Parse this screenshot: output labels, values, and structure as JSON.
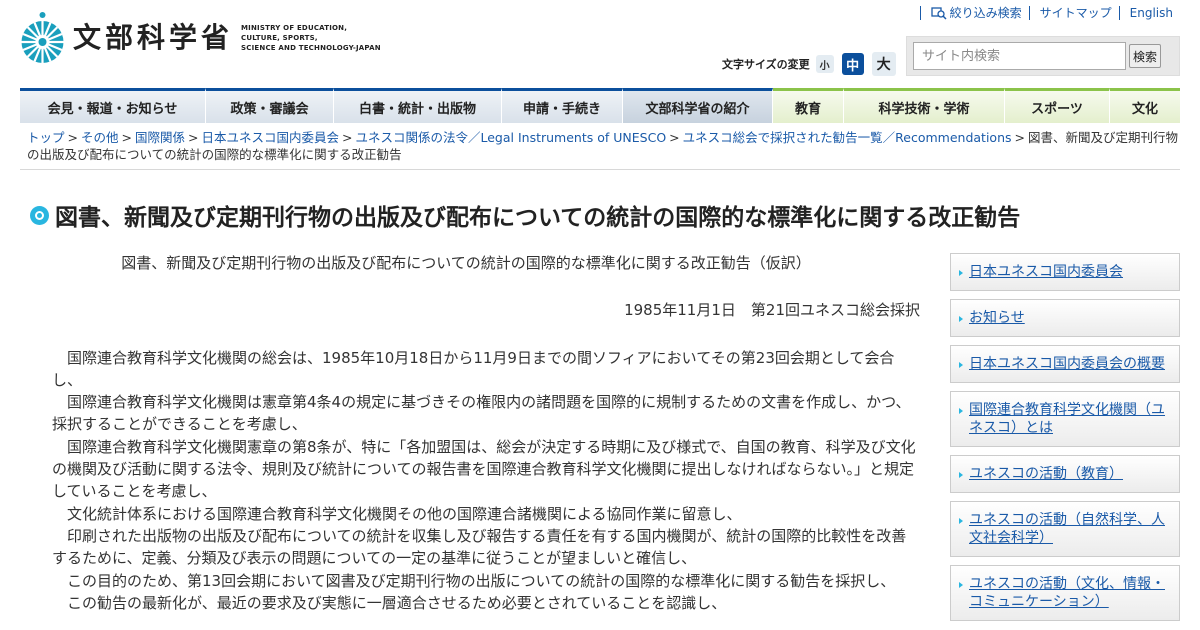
{
  "header": {
    "logo_jp": "文部科学省",
    "logo_en": [
      "MINISTRY OF EDUCATION,",
      "CULTURE, SPORTS,",
      "SCIENCE AND TECHNOLOGY-JAPAN"
    ],
    "logo_color": "#1a9fbd",
    "links": [
      "絞り込み検索",
      "サイトマップ",
      "English"
    ],
    "font_size_label": "文字サイズの変更",
    "font_sizes": [
      "小",
      "中",
      "大"
    ],
    "search_placeholder": "サイト内検索",
    "search_button": "検索"
  },
  "nav": {
    "items": [
      "会見・報道・お知らせ",
      "政策・審議会",
      "白書・統計・出版物",
      "申請・手続き",
      "文部科学省の紹介",
      "教育",
      "科学技術・学術",
      "スポーツ",
      "文化"
    ],
    "primary_color": "#0b4f9c",
    "secondary_color": "#8bc34a"
  },
  "breadcrumb": {
    "links": [
      "トップ",
      "その他",
      "国際関係",
      "日本ユネスコ国内委員会",
      "ユネスコ関係の法令／Legal Instruments of UNESCO",
      "ユネスコ総会で採択された勧告一覧／Recommendations"
    ],
    "current": "図書、新聞及び定期刊行物の出版及び配布についての統計の国際的な標準化に関する改正勧告"
  },
  "page_title": "図書、新聞及び定期刊行物の出版及び配布についての統計の国際的な標準化に関する改正勧告",
  "main": {
    "heading": "図書、新聞及び定期刊行物の出版及び配布についての統計の国際的な標準化に関する改正勧告（仮訳）",
    "date": "1985年11月1日　第21回ユネスコ総会採択",
    "paragraphs": [
      "国際連合教育科学文化機関の総会は、1985年10月18日から11月9日までの間ソフィアにおいてその第23回会期として会合し、",
      "国際連合教育科学文化機関は憲章第4条4の規定に基づきその権限内の諸問題を国際的に規制するための文書を作成し、かつ、採択することができることを考慮し、",
      "国際連合教育科学文化機関憲章の第8条が、特に「各加盟国は、総会が決定する時期に及び様式で、自国の教育、科学及び文化の機関及び活動に関する法令、規則及び統計についての報告書を国際連合教育科学文化機関に提出しなければならない。」と規定していることを考慮し、",
      "文化統計体系における国際連合教育科学文化機関その他の国際連合諸機関による協同作業に留意し、",
      "印刷された出版物の出版及び配布についての統計を収集し及び報告する責任を有する国内機関が、統計の国際的比較性を改善するために、定義、分類及び表示の問題についての一定の基準に従うことが望ましいと確信し、",
      "この目的のため、第13回会期において図書及び定期刊行物の出版についての統計の国際的な標準化に関する勧告を採択し、",
      "この勧告の最新化が、最近の要求及び実態に一層適合させるため必要とされていることを認識し、"
    ]
  },
  "sidebar": {
    "items": [
      "日本ユネスコ国内委員会",
      "お知らせ",
      "日本ユネスコ国内委員会の概要",
      "国際連合教育科学文化機関（ユネスコ）とは",
      "ユネスコの活動（教育）",
      "ユネスコの活動（自然科学、人文社会科学）",
      "ユネスコの活動（文化、情報・コミュニケーション）"
    ]
  }
}
